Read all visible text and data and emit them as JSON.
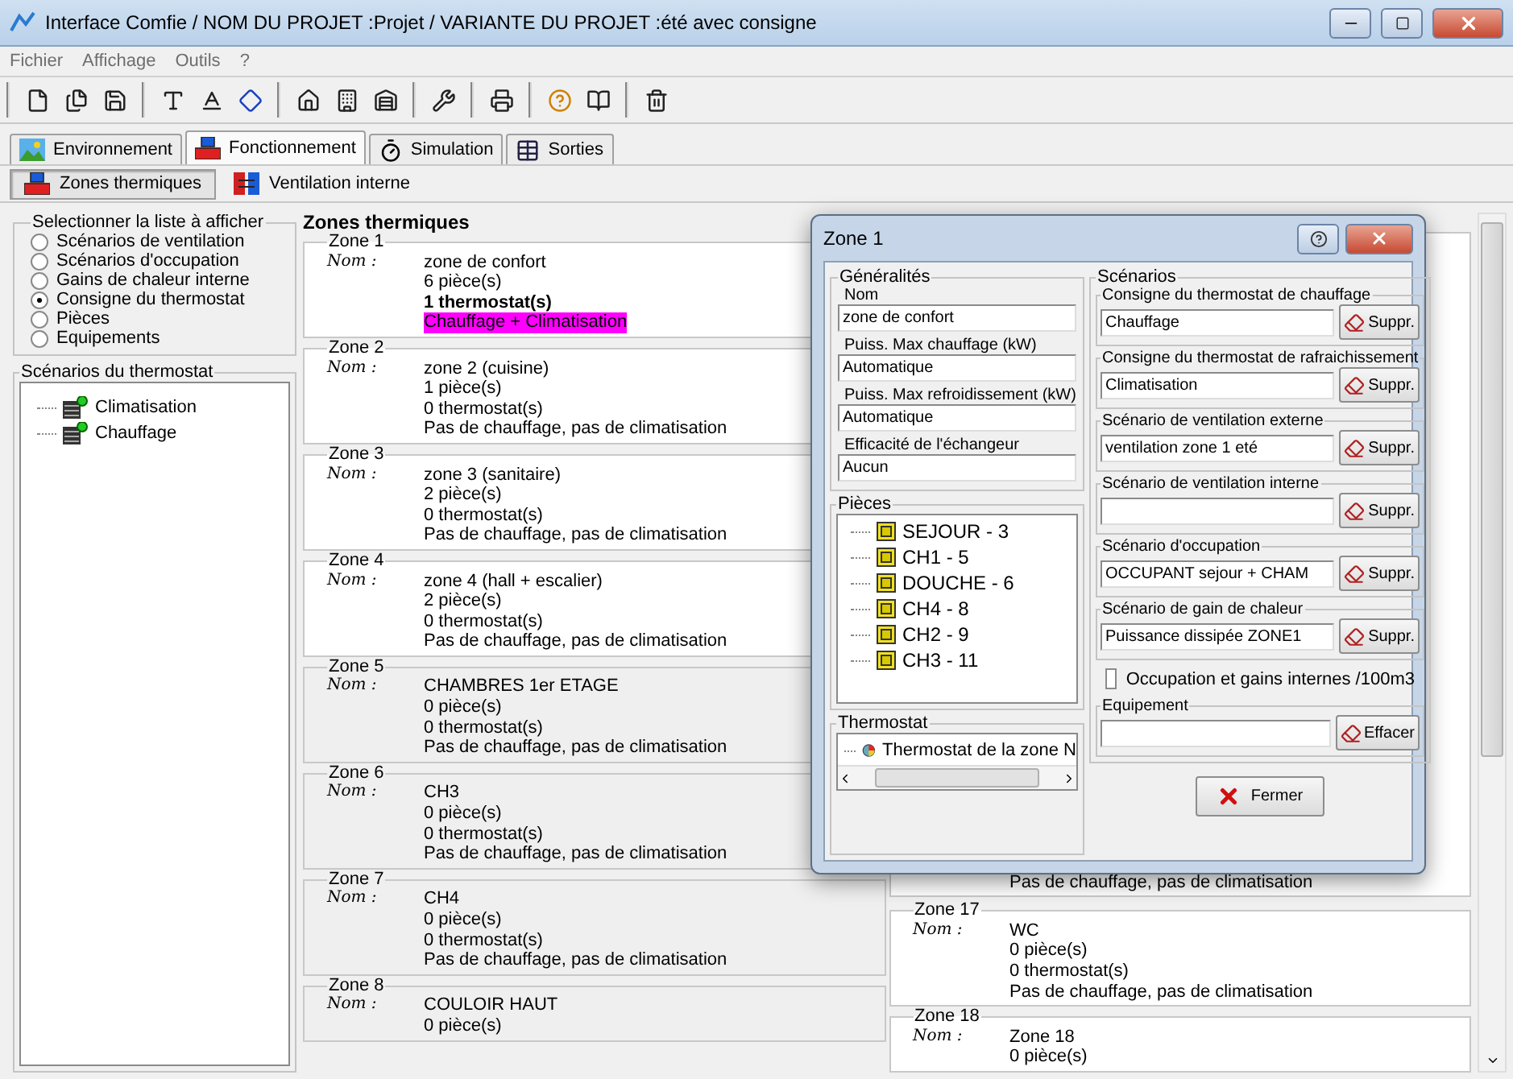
{
  "window": {
    "title": "Interface Comfie  /  NOM DU PROJET :Projet  /  VARIANTE DU PROJET :été avec consigne"
  },
  "menu": [
    "Fichier",
    "Affichage",
    "Outils",
    "?"
  ],
  "toolbar_groups": [
    [
      {
        "kind": "new-file"
      },
      {
        "kind": "copy-file"
      },
      {
        "kind": "save-file"
      }
    ],
    [
      {
        "kind": "text-a"
      },
      {
        "kind": "text-b"
      },
      {
        "kind": "diamond"
      }
    ],
    [
      {
        "kind": "house-a"
      },
      {
        "kind": "house-b"
      },
      {
        "kind": "house-c"
      }
    ],
    [
      {
        "kind": "tools"
      }
    ],
    [
      {
        "kind": "printer"
      }
    ],
    [
      {
        "kind": "help"
      },
      {
        "kind": "book"
      }
    ],
    [
      {
        "kind": "trash"
      }
    ]
  ],
  "tabs": [
    {
      "label": "Environnement",
      "selected": false,
      "kind": "landscape"
    },
    {
      "label": "Fonctionnement",
      "selected": true,
      "kind": "blocks"
    },
    {
      "label": "Simulation",
      "selected": false,
      "kind": "stopwatch"
    },
    {
      "label": "Sorties",
      "selected": false,
      "kind": "grid"
    }
  ],
  "subtabs": [
    {
      "label": "Zones thermiques",
      "selected": true,
      "kind": "blocks"
    },
    {
      "label": "Ventilation interne",
      "selected": false,
      "kind": "arrows"
    }
  ],
  "list_selector": {
    "title": "Selectionner la liste à afficher",
    "options": [
      {
        "label": "Scénarios de ventilation",
        "selected": false
      },
      {
        "label": "Scénarios d'occupation",
        "selected": false
      },
      {
        "label": "Gains de chaleur interne",
        "selected": false
      },
      {
        "label": "Consigne du thermostat",
        "selected": true
      },
      {
        "label": "Pièces",
        "selected": false
      },
      {
        "label": "Equipements",
        "selected": false
      }
    ]
  },
  "thermostat_scenarios": {
    "title": "Scénarios du thermostat",
    "items": [
      "Climatisation",
      "Chauffage"
    ]
  },
  "zones_title": "Zones thermiques",
  "zones_left": [
    {
      "title": "Zone 1",
      "label": "Nom :",
      "name": "zone de confort",
      "rooms": "6 pièce(s)",
      "thermostats": "1 thermostat(s)",
      "mode": "Chauffage + Climatisation",
      "has_thermostat": true,
      "shaded": false
    },
    {
      "title": "Zone 2",
      "label": "Nom :",
      "name": "zone 2 (cuisine)",
      "rooms": "1 pièce(s)",
      "thermostats": "0 thermostat(s)",
      "mode": "Pas de chauffage, pas de climatisation",
      "has_thermostat": false,
      "shaded": false
    },
    {
      "title": "Zone 3",
      "label": "Nom :",
      "name": "zone 3 (sanitaire)",
      "rooms": "2 pièce(s)",
      "thermostats": "0 thermostat(s)",
      "mode": "Pas de chauffage, pas de climatisation",
      "has_thermostat": false,
      "shaded": false
    },
    {
      "title": "Zone 4",
      "label": "Nom :",
      "name": "zone 4 (hall + escalier)",
      "rooms": "2 pièce(s)",
      "thermostats": "0 thermostat(s)",
      "mode": "Pas de chauffage, pas de climatisation",
      "has_thermostat": false,
      "shaded": false
    },
    {
      "title": "Zone 5",
      "label": "Nom :",
      "name": "CHAMBRES 1er ETAGE",
      "rooms": "0 pièce(s)",
      "thermostats": "0 thermostat(s)",
      "mode": "Pas de chauffage, pas de climatisation",
      "has_thermostat": false,
      "shaded": true
    },
    {
      "title": "Zone 6",
      "label": "Nom :",
      "name": "CH3",
      "rooms": "0 pièce(s)",
      "thermostats": "0 thermostat(s)",
      "mode": "Pas de chauffage, pas de climatisation",
      "has_thermostat": false,
      "shaded": true
    },
    {
      "title": "Zone 7",
      "label": "Nom :",
      "name": "CH4",
      "rooms": "0 pièce(s)",
      "thermostats": "0 thermostat(s)",
      "mode": "Pas de chauffage, pas de climatisation",
      "has_thermostat": false,
      "shaded": true
    },
    {
      "title": "Zone 8",
      "label": "Nom :",
      "name": "COULOIR HAUT",
      "rooms": "0 pièce(s)",
      "shaded": true
    }
  ],
  "zones_right_partial": {
    "mode": "Pas de chauffage, pas de climatisation"
  },
  "zones_right": [
    {
      "title": "Zone 17",
      "label": "Nom :",
      "name": "WC",
      "rooms": "0 pièce(s)",
      "thermostats": "0 thermostat(s)",
      "mode": "Pas de chauffage, pas de climatisation",
      "has_thermostat": false,
      "shaded": false
    },
    {
      "title": "Zone 18",
      "label": "Nom :",
      "name": "Zone 18",
      "rooms": "0 pièce(s)",
      "shaded": false
    }
  ],
  "dialog": {
    "title": "Zone 1",
    "general": {
      "title": "Généralités",
      "fields": [
        {
          "label": "Nom",
          "value": "zone de confort"
        },
        {
          "label": "Puiss. Max chauffage (kW)",
          "value": "Automatique"
        },
        {
          "label": "Puiss. Max refroidissement (kW)",
          "value": "Automatique"
        },
        {
          "label": "Efficacité de l'échangeur",
          "value": "Aucun"
        }
      ]
    },
    "rooms": {
      "title": "Pièces",
      "items": [
        "SEJOUR - 3",
        "CH1 - 5",
        "DOUCHE - 6",
        "CH4 - 8",
        "CH2 - 9",
        "CH3 - 11"
      ]
    },
    "thermostat": {
      "title": "Thermostat",
      "items": [
        "Thermostat de la zone N"
      ]
    },
    "scenarios": {
      "title": "Scénarios",
      "groups": [
        {
          "title": "Consigne du thermostat de chauffage",
          "value": "Chauffage",
          "button": "Suppr."
        },
        {
          "title": "Consigne du thermostat de rafraichissement",
          "value": "Climatisation",
          "button": "Suppr."
        },
        {
          "title": "Scénario de ventilation externe",
          "value": "ventilation zone 1 eté",
          "button": "Suppr."
        },
        {
          "title": "Scénario de ventilation interne",
          "button": "Suppr."
        },
        {
          "title": "Scénario d'occupation",
          "value": "OCCUPANT sejour + CHAM",
          "button": "Suppr."
        },
        {
          "title": "Scénario de gain de chaleur",
          "value": "Puissance dissipée ZONE1",
          "button": "Suppr."
        }
      ]
    },
    "checkbox": {
      "label": "Occupation et gains internes /100m3",
      "checked": false
    },
    "equipment": {
      "title": "Equipement",
      "button": "Effacer"
    },
    "close_button": "Fermer"
  }
}
